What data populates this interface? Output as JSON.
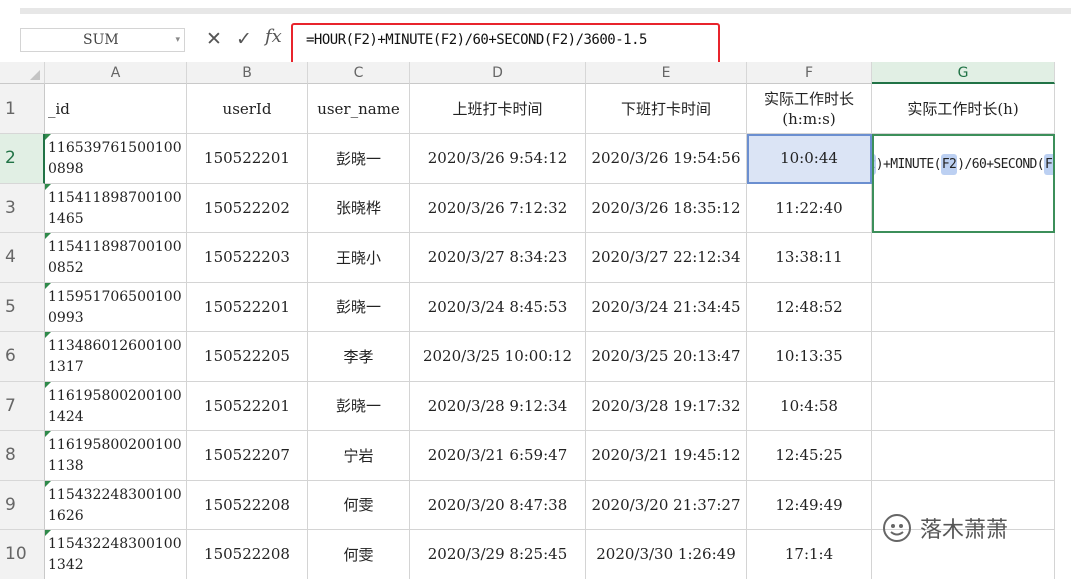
{
  "formula_bar": {
    "name_box": "SUM",
    "cancel_icon": "✕",
    "confirm_icon": "✓",
    "fx_label": "fx",
    "formula": "=HOUR(F2)+MINUTE(F2)/60+SECOND(F2)/3600-1.5"
  },
  "columns": [
    "A",
    "B",
    "C",
    "D",
    "E",
    "F",
    "G"
  ],
  "row_numbers": [
    "1",
    "2",
    "3",
    "4",
    "5",
    "6",
    "7",
    "8",
    "9",
    "10"
  ],
  "headers": {
    "id": "_id",
    "userId": "userId",
    "user_name": "user_name",
    "clock_in": "上班打卡时间",
    "clock_out": "下班打卡时间",
    "work_hms": "实际工作时长(h:m:s)",
    "work_h": "实际工作时长(h)"
  },
  "rows": [
    {
      "id": "1165397615001000898",
      "userId": "150522201",
      "user_name": "彭晓一",
      "clock_in": "2020/3/26 9:54:12",
      "clock_out": "2020/3/26 19:54:56",
      "work_hms": "10:0:44"
    },
    {
      "id": "1154118987001001465",
      "userId": "150522202",
      "user_name": "张晓桦",
      "clock_in": "2020/3/26 7:12:32",
      "clock_out": "2020/3/26 18:35:12",
      "work_hms": "11:22:40"
    },
    {
      "id": "1154118987001000852",
      "userId": "150522203",
      "user_name": "王晓小",
      "clock_in": "2020/3/27 8:34:23",
      "clock_out": "2020/3/27 22:12:34",
      "work_hms": "13:38:11"
    },
    {
      "id": "1159517065001000993",
      "userId": "150522201",
      "user_name": "彭晓一",
      "clock_in": "2020/3/24 8:45:53",
      "clock_out": "2020/3/24 21:34:45",
      "work_hms": "12:48:52"
    },
    {
      "id": "1134860126001001317",
      "userId": "150522205",
      "user_name": "李孝",
      "clock_in": "2020/3/25 10:00:12",
      "clock_out": "2020/3/25 20:13:47",
      "work_hms": "10:13:35"
    },
    {
      "id": "1161958002001001424",
      "userId": "150522201",
      "user_name": "彭晓一",
      "clock_in": "2020/3/28 9:12:34",
      "clock_out": "2020/3/28 19:17:32",
      "work_hms": "10:4:58"
    },
    {
      "id": "1161958002001001138",
      "userId": "150522207",
      "user_name": "宁岩",
      "clock_in": "2020/3/21 6:59:47",
      "clock_out": "2020/3/21 19:45:12",
      "work_hms": "12:45:25"
    },
    {
      "id": "1154322483001001626",
      "userId": "150522208",
      "user_name": "何雯",
      "clock_in": "2020/3/20 8:47:38",
      "clock_out": "2020/3/20 21:37:27",
      "work_hms": "12:49:49"
    },
    {
      "id": "1154322483001001342",
      "userId": "150522208",
      "user_name": "何雯",
      "clock_in": "2020/3/29 8:25:45",
      "clock_out": "2020/3/30 1:26:49",
      "work_hms": "17:1:4"
    }
  ],
  "editing_cell": {
    "part1": "=HOUR(",
    "ref1": "F2",
    "part2": ")+MINUTE(",
    "ref2": "F2",
    "part3": ")/60+SECOND(",
    "ref3": "F2",
    "part4": ")/3600-1.5"
  },
  "watermark": "落木萧萧",
  "colors": {
    "selection_green": "#217346",
    "active_blue": "#dbe4f5",
    "highlight_red": "#e8242c"
  }
}
